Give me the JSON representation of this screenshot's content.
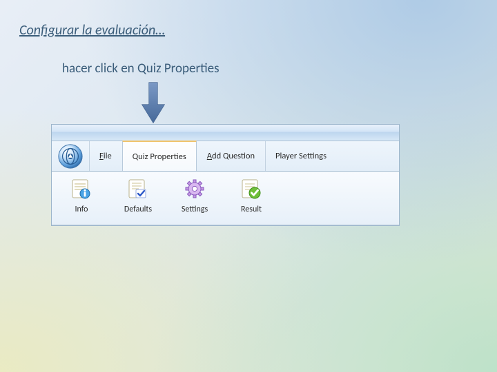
{
  "slide": {
    "title": "Configurar la evaluación…",
    "instruction": "hacer click en Quiz Properties"
  },
  "app": {
    "tabs": {
      "file": "File",
      "quiz_properties": "Quiz Properties",
      "add_question": "Add Question",
      "player_settings": "Player Settings"
    },
    "toolbar": {
      "info": "Info",
      "defaults": "Defaults",
      "settings": "Settings",
      "result": "Result"
    }
  },
  "colors": {
    "accent": "#3b5d7a",
    "arrow": "#4b6fa0",
    "tab_highlight": "#f0c36a"
  }
}
